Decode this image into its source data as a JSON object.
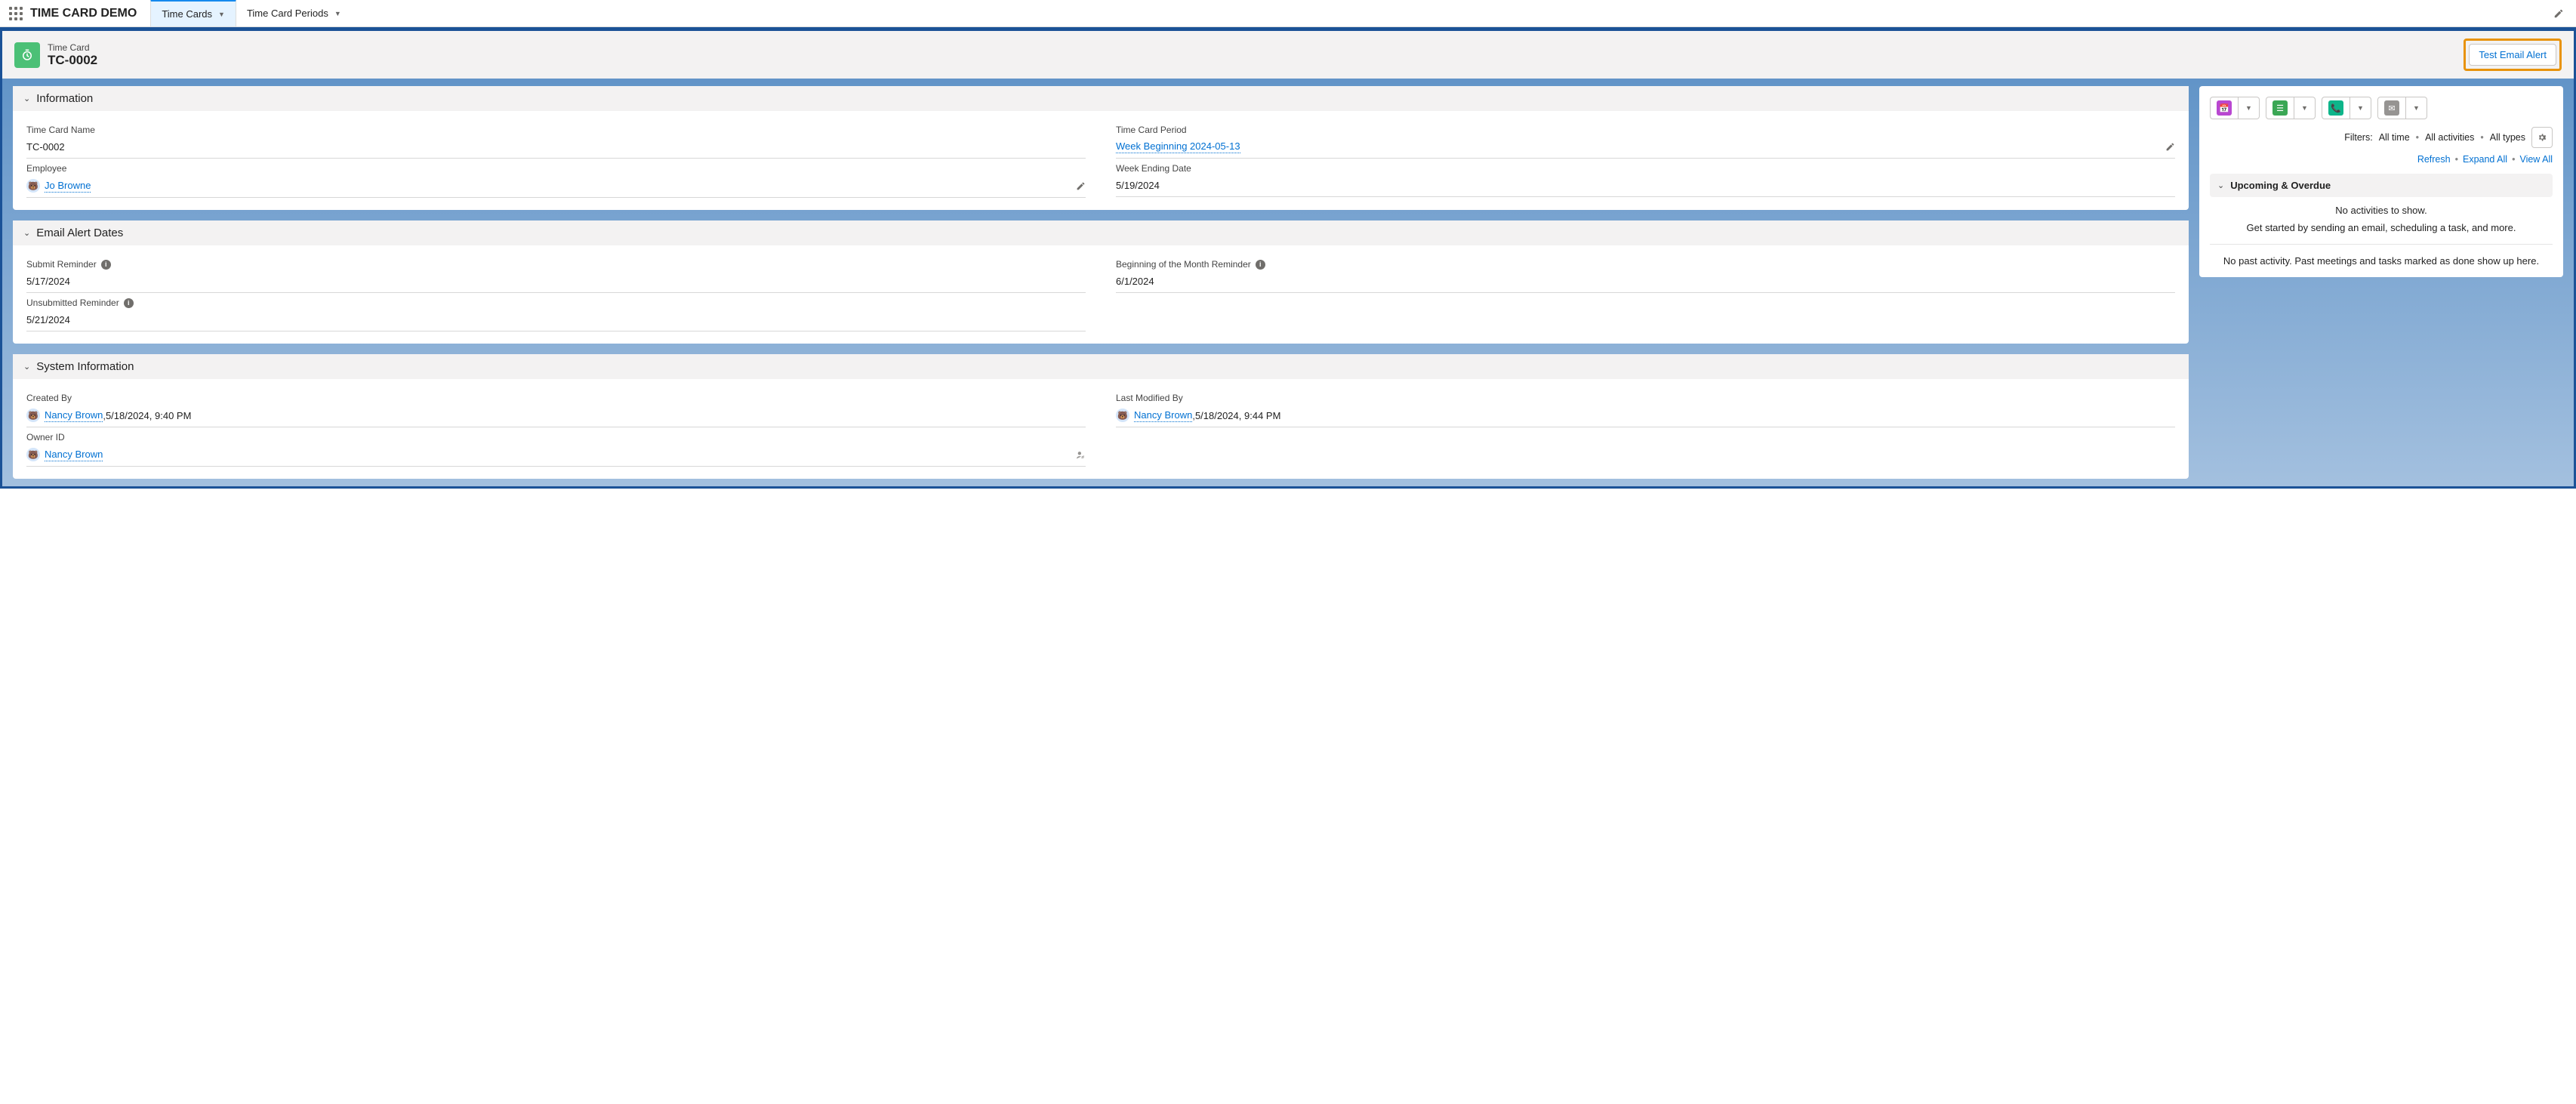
{
  "app_name": "TIME CARD DEMO",
  "tabs": [
    {
      "label": "Time Cards",
      "active": true
    },
    {
      "label": "Time Card Periods",
      "active": false
    }
  ],
  "header": {
    "record_type": "Time Card",
    "record_title": "TC-0002",
    "action_button": "Test Email Alert"
  },
  "sections": {
    "info": {
      "title": "Information",
      "fields": {
        "time_card_name": {
          "label": "Time Card Name",
          "value": "TC-0002"
        },
        "time_card_period": {
          "label": "Time Card Period",
          "value": "Week Beginning 2024-05-13"
        },
        "employee": {
          "label": "Employee",
          "value": "Jo Browne"
        },
        "week_ending": {
          "label": "Week Ending Date",
          "value": "5/19/2024"
        }
      }
    },
    "email_alerts": {
      "title": "Email Alert Dates",
      "fields": {
        "submit_reminder": {
          "label": "Submit Reminder",
          "value": "5/17/2024"
        },
        "month_reminder": {
          "label": "Beginning of the Month Reminder",
          "value": "6/1/2024"
        },
        "unsubmitted_reminder": {
          "label": "Unsubmitted Reminder",
          "value": "5/21/2024"
        }
      }
    },
    "system_info": {
      "title": "System Information",
      "fields": {
        "created_by": {
          "label": "Created By",
          "user": "Nancy Brown",
          "timestamp": "5/18/2024, 9:40 PM"
        },
        "last_modified_by": {
          "label": "Last Modified By",
          "user": "Nancy Brown",
          "timestamp": "5/18/2024, 9:44 PM"
        },
        "owner_id": {
          "label": "Owner ID",
          "user": "Nancy Brown"
        }
      }
    }
  },
  "activity": {
    "filters_label": "Filters:",
    "filter_time": "All time",
    "filter_activities": "All activities",
    "filter_types": "All types",
    "link_refresh": "Refresh",
    "link_expand": "Expand All",
    "link_view_all": "View All",
    "upcoming_title": "Upcoming & Overdue",
    "empty_line1": "No activities to show.",
    "empty_line2": "Get started by sending an email, scheduling a task, and more.",
    "past_text": "No past activity. Past meetings and tasks marked as done show up here."
  }
}
